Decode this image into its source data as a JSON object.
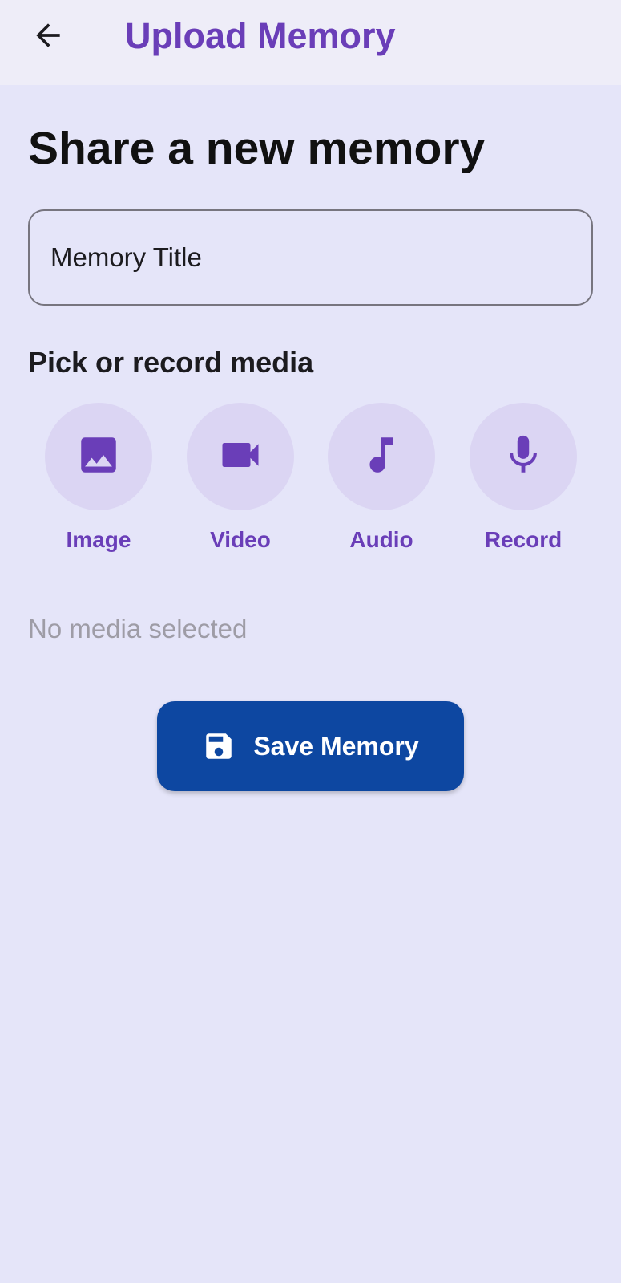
{
  "app_bar": {
    "title": "Upload Memory",
    "back_icon": "arrow-back-icon"
  },
  "main": {
    "heading": "Share a new memory",
    "title_field": {
      "placeholder": "Memory Title",
      "value": ""
    },
    "media_section_label": "Pick or record media",
    "media_options": [
      {
        "label": "Image",
        "icon": "image-icon"
      },
      {
        "label": "Video",
        "icon": "videocam-icon"
      },
      {
        "label": "Audio",
        "icon": "music-note-icon"
      },
      {
        "label": "Record",
        "icon": "mic-icon"
      }
    ],
    "status_text": "No media selected",
    "save_button": {
      "label": "Save Memory",
      "icon": "save-icon"
    }
  },
  "colors": {
    "background": "#e5e5f9",
    "app_bar_background": "#eeedf8",
    "accent": "#6a3eb8",
    "media_circle": "#dbd5f3",
    "primary_button": "#0d47a1",
    "muted_text": "#9e9ca6"
  }
}
